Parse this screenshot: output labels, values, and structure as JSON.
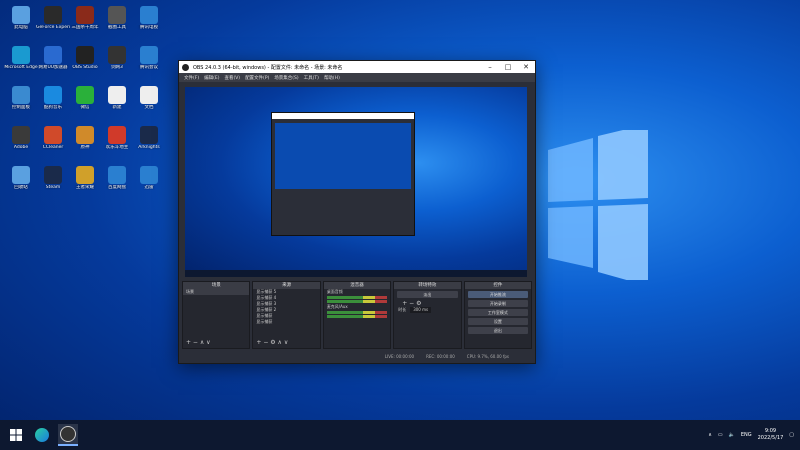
{
  "desktop": {
    "icons": [
      {
        "label": "此电脑",
        "color": "#5aa0e0"
      },
      {
        "label": "GeForce Experience",
        "color": "#2a2a2a"
      },
      {
        "label": "三国杀十周年",
        "color": "#8a2a1a"
      },
      {
        "label": "截图工具",
        "color": "#555"
      },
      {
        "label": "腾讯电视",
        "color": "#2a7fd0"
      },
      {
        "label": "Microsoft Edge",
        "color": "#1a9ad0"
      },
      {
        "label": "网易UU加速器",
        "color": "#2a6ad0"
      },
      {
        "label": "OBS Studio",
        "color": "#222"
      },
      {
        "label": "剑网3",
        "color": "#333"
      },
      {
        "label": "腾讯会议",
        "color": "#2a7fd0"
      },
      {
        "label": "控制面板",
        "color": "#3a8ad0"
      },
      {
        "label": "酷狗音乐",
        "color": "#1a8ae0"
      },
      {
        "label": "微信",
        "color": "#2ab03a"
      },
      {
        "label": "新建",
        "color": "#eee"
      },
      {
        "label": "文档",
        "color": "#eee"
      },
      {
        "label": "Adobe",
        "color": "#3a3a3a"
      },
      {
        "label": "CCleaner",
        "color": "#d04a2a"
      },
      {
        "label": "原神",
        "color": "#d08a2a"
      },
      {
        "label": "欢乐斗地主",
        "color": "#d03a2a"
      },
      {
        "label": "Arknights",
        "color": "#1a2a4a"
      },
      {
        "label": "回收站",
        "color": "#5aa0e0"
      },
      {
        "label": "Steam",
        "color": "#1a2a4a"
      },
      {
        "label": "王者荣耀",
        "color": "#d0a02a"
      },
      {
        "label": "百度网盘",
        "color": "#2a7fd0"
      },
      {
        "label": "迅雷",
        "color": "#2a7fd0"
      }
    ]
  },
  "obs": {
    "title": "OBS 24.0.3 (64-bit, windows) - 配置文件: 未命名 - 场景: 未命名",
    "menu": [
      "文件(F)",
      "编辑(E)",
      "查看(V)",
      "配置文件(P)",
      "场景集合(S)",
      "工具(T)",
      "帮助(H)"
    ],
    "docks": {
      "scenes": {
        "title": "场景",
        "items": [
          "场景"
        ]
      },
      "sources": {
        "title": "来源",
        "items": [
          "显示捕获 5",
          "显示捕获 4",
          "显示捕获 3",
          "显示捕获 2",
          "显示捕获",
          "显示捕获"
        ]
      },
      "mixer": {
        "title": "混音器",
        "items": [
          "桌面音频",
          "麦克风/Aux"
        ]
      },
      "transitions": {
        "title": "转场特效",
        "mode": "淡出",
        "duration_label": "时长",
        "duration": "300 ms"
      },
      "controls": {
        "title": "控件",
        "buttons": [
          "开始推流",
          "开始录制",
          "工作室模式",
          "设置",
          "退出"
        ]
      }
    },
    "status": {
      "live": "LIVE: 00:00:00",
      "rec": "REC: 00:00:00",
      "cpu": "CPU: 9.7%, 60.00 fps"
    }
  },
  "taskbar": {
    "lang": "ENG",
    "time": "9:09",
    "date": "2022/5/17"
  }
}
